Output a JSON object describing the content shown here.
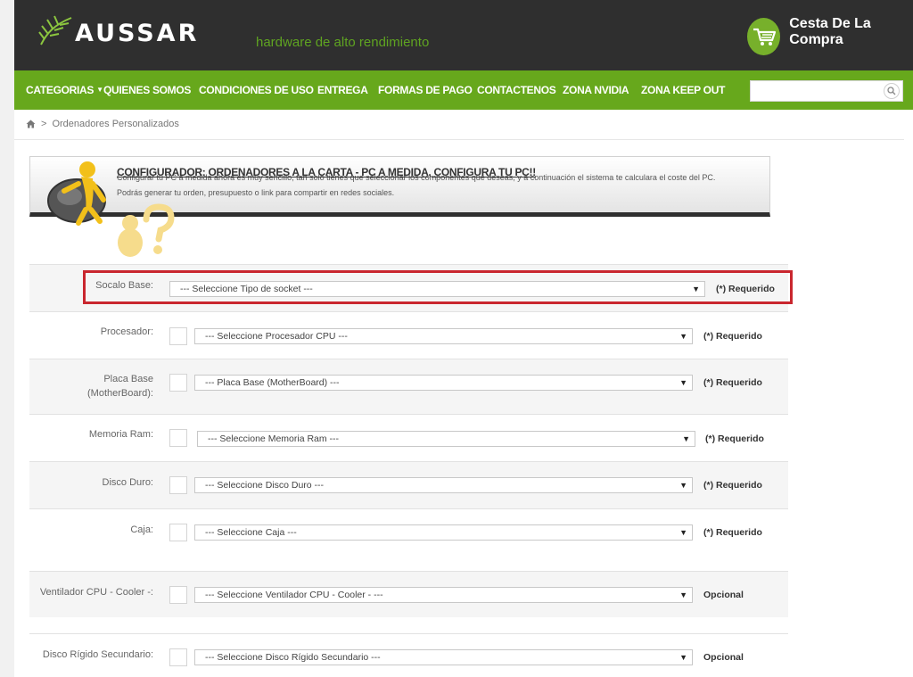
{
  "header": {
    "logo_text": "AUSSAR",
    "tagline": "hardware de alto rendimiento",
    "cart_label": "Cesta De La Compra"
  },
  "nav": {
    "items": [
      {
        "label": "CATEGORIAS"
      },
      {
        "label": "QUIENES SOMOS"
      },
      {
        "label": "CONDICIONES DE USO"
      },
      {
        "label": "ENTREGA"
      },
      {
        "label": "FORMAS DE PAGO"
      },
      {
        "label": "CONTACTENOS"
      },
      {
        "label": "ZONA NVIDIA"
      },
      {
        "label": "ZONA KEEP OUT"
      }
    ],
    "search_placeholder": ""
  },
  "breadcrumb": {
    "separator": ">",
    "current": "Ordenadores Personalizados"
  },
  "banner": {
    "title": "CONFIGURADOR: ORDENADORES A LA CARTA - PC A MEDIDA, CONFIGURA TU PC!!",
    "text": "Configurar tu PC a medida ahora es muy sencillo, tan solo tienes que seleccionar los componentes que deseas, y a continuación el sistema te calculara el coste del PC. Podrás generar tu orden, presupuesto o link para compartir en redes sociales."
  },
  "form": {
    "rows": [
      {
        "label": "Socalo Base:",
        "select": "--- Seleccione Tipo de socket ---",
        "status": "(*) Requerido"
      },
      {
        "label": "Procesador:",
        "select": "--- Seleccione Procesador CPU ---",
        "status": "(*) Requerido"
      },
      {
        "label": "Placa Base (MotherBoard):",
        "select": "--- Placa Base (MotherBoard) ---",
        "status": "(*) Requerido"
      },
      {
        "label": "Memoria Ram:",
        "select": "--- Seleccione Memoria Ram ---",
        "status": "(*) Requerido"
      },
      {
        "label": "Disco Duro:",
        "select": "--- Seleccione Disco Duro ---",
        "status": "(*) Requerido"
      },
      {
        "label": "Caja:",
        "select": "--- Seleccione Caja ---",
        "status": "(*) Requerido"
      },
      {
        "label": "Ventilador CPU - Cooler -:",
        "select": "--- Seleccione Ventilador CPU - Cooler - ---",
        "status": "Opcional"
      },
      {
        "label": "Disco Rígido Secundario:",
        "select": "--- Seleccione Disco Rígido Secundario ---",
        "status": "Opcional"
      }
    ]
  },
  "colors": {
    "header_bg": "#2f2f2f",
    "nav_green": "#67a81c",
    "accent_green": "#5fa321",
    "highlight_red": "#c9262e"
  }
}
